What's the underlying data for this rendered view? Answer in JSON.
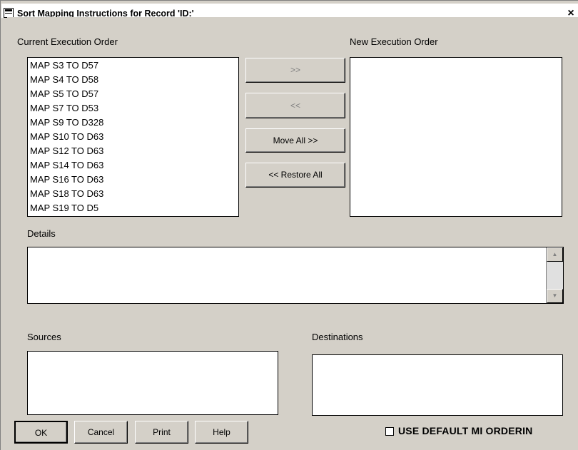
{
  "window": {
    "title": "Sort Mapping Instructions for Record 'ID:'",
    "close_glyph": "×"
  },
  "labels": {
    "current_order": "Current Execution Order",
    "new_order": "New Execution Order",
    "details": "Details",
    "sources": "Sources",
    "destinations": "Destinations"
  },
  "current_order_items": [
    "MAP S3 TO D57",
    "MAP S4 TO D58",
    "MAP S5 TO D57",
    "MAP S7 TO D53",
    "MAP S9 TO D328",
    "MAP S10 TO D63",
    "MAP S12 TO D63",
    "MAP S14 TO D63",
    "MAP S16 TO D63",
    "MAP S18 TO D63",
    "MAP S19 TO D5"
  ],
  "move_buttons": {
    "move_right": ">>",
    "move_left": "<<",
    "move_all": "Move All >>",
    "restore_all": "<< Restore All"
  },
  "footer": {
    "ok": "OK",
    "cancel": "Cancel",
    "print": "Print",
    "help": "Help",
    "use_default_label": "USE DEFAULT MI ORDERIN"
  },
  "icons": {
    "scroll_up": "▲",
    "scroll_down": "▼"
  }
}
